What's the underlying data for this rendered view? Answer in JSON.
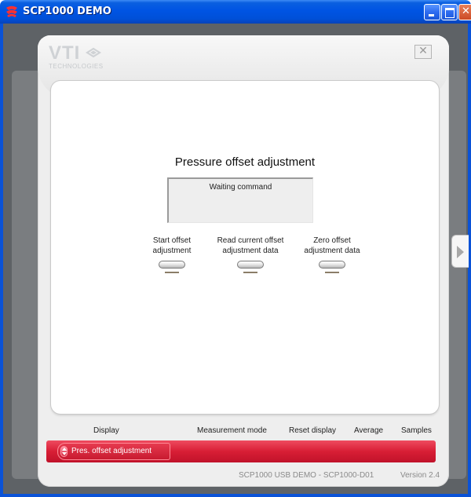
{
  "window": {
    "title": "SCP1000 DEMO",
    "icon": "vti-app-icon"
  },
  "logo": {
    "main": "VTI",
    "sub": "TECHNOLOGIES"
  },
  "panel": {
    "close_glyph": "✕"
  },
  "main": {
    "title": "Pressure offset adjustment",
    "status": "Waiting command",
    "actions": [
      {
        "line1": "Start offset",
        "line2": "adjustment"
      },
      {
        "line1": "Read current offset",
        "line2": "adjustment data"
      },
      {
        "line1": "Zero offset",
        "line2": "adjustment data"
      }
    ]
  },
  "nav": {
    "display": "Display",
    "measurement_mode": "Measurement mode",
    "reset_display": "Reset display",
    "average": "Average",
    "samples": "Samples"
  },
  "mode_selector": {
    "value": "Pres. offset adjustment"
  },
  "footer": {
    "device": "SCP1000 USB DEMO - SCP1000-D01",
    "version": "Version 2.4"
  },
  "colors": {
    "titlebar": "#0054e3",
    "accent_red": "#d81e35",
    "panel_gray": "#eeeeee",
    "frame_dark": "#5e6266"
  }
}
